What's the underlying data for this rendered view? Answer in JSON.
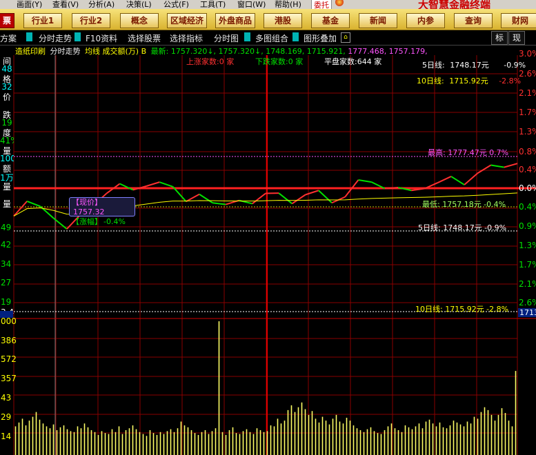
{
  "menubar": {
    "items": [
      "画面(Y)",
      "查看(V)",
      "分析(A)",
      "决策(L)",
      "公式(F)",
      "工具(T)",
      "窗口(W)",
      "帮助(H)"
    ],
    "trade_badge": "委托",
    "brand": "大智慧金融终端"
  },
  "function_buttons": [
    "票",
    "行业1",
    "行业2",
    "概念",
    "区域经济",
    "外盘商品",
    "港股",
    "基金",
    "新闻",
    "内参",
    "查询",
    "财网"
  ],
  "toolbar": {
    "items": [
      "方案",
      "分时走势",
      "F10资料",
      "选择股票",
      "选择指标",
      "分时图",
      "多图组合",
      "图形叠加"
    ],
    "right_buttons": [
      "标",
      "现"
    ]
  },
  "info_line": {
    "name": "造纸印刷",
    "chart_label": "分时走势",
    "indicators": "均线 成交额(万) B",
    "latest_label": "最新:",
    "latest_values": "1757.320↓, 1757.320↓, 1748.169, 1715.921,",
    "purple_values": "1777.468, 1757.179,"
  },
  "stats": {
    "rising": "上涨家数:0 家",
    "falling": "下跌家数:0 家",
    "flat": "平盘家数:644 家"
  },
  "ma_box": {
    "ma5_label": "5日线:",
    "ma5_value": "1748.17元",
    "ma5_pct": "-0.9%",
    "ma10_label": "10日线:",
    "ma10_value": "1715.92元",
    "ma10_pct": "-2.8%"
  },
  "overlays": {
    "high": "最高: 1777.47元 0.7%",
    "low": "最低: 1757.18元 -0.4%",
    "ma5": "5日线: 1748.17元 -0.9%",
    "ma10": "10日线: 1715.92元 -2.8%"
  },
  "tooltip": {
    "price_label": "【现价】",
    "price_value": "1757.32",
    "change_label": "【涨幅】",
    "change_value": "-0.4%"
  },
  "left_panel": [
    "间",
    "48",
    "格",
    "32",
    "价",
    "跌",
    "19",
    "度",
    "41%",
    "量",
    "100",
    "额",
    "1万",
    "量",
    "量"
  ],
  "left_price_axis": [
    "49",
    "42",
    "34",
    "27",
    "19",
    "3.4"
  ],
  "left_volume_axis": [
    "000",
    "386",
    "572",
    "357",
    "43",
    "29",
    "14"
  ],
  "right_axis_labels": [
    "3.0%",
    "2.6%",
    "2.1%",
    "1.7%",
    "1.3%",
    "0.8%",
    "0.4%",
    "0.0%",
    "0.4%",
    "0.9%",
    "1.3%",
    "1.7%",
    "2.1%",
    "2.6%"
  ],
  "right_volume_label": "1713",
  "colors": {
    "grid": "#8a0000",
    "up": "#ff3030",
    "down": "#00e000",
    "avg": "#ffff00",
    "zero": "#ff2020",
    "volume": "#ffff66",
    "purple": "#ff55ff"
  },
  "chart_data": [
    {
      "type": "line",
      "series": [
        {
          "values": [
            1757.0,
            1762.5,
            1760.6,
            1756.2,
            1752.2,
            1757.4,
            1760.9,
            1765.4,
            1769.0,
            1766.7,
            1768.1,
            1769.6,
            1767.9,
            1762.4,
            1765.1,
            1761.9,
            1761.3,
            1762.8,
            1761.6,
            1765.4,
            1765.5,
            1761.6,
            1764.9,
            1766.5,
            1761.9,
            1764.1,
            1770.4,
            1769.6,
            1767.2,
            1767.6,
            1766.5,
            1767.2,
            1769.4,
            1771.7,
            1768.6,
            1772.9,
            1775.9,
            1775.1,
            1776.5
          ]
        }
      ]
    },
    {
      "type": "bar",
      "values": [
        30,
        34,
        38,
        31,
        36,
        40,
        45,
        37,
        33,
        30,
        28,
        32,
        26,
        29,
        31,
        27,
        25,
        24,
        30,
        28,
        33,
        29,
        26,
        24,
        21,
        25,
        23,
        22,
        27,
        24,
        30,
        22,
        26,
        28,
        31,
        27,
        24,
        22,
        20,
        26,
        23,
        21,
        24,
        22,
        25,
        27,
        24,
        28,
        35,
        31,
        29,
        26,
        23,
        21,
        24,
        26,
        22,
        25,
        28,
        140,
        24,
        21,
        26,
        29,
        23,
        22,
        25,
        27,
        24,
        22,
        28,
        26,
        24,
        25,
        31,
        30,
        38,
        33,
        36,
        47,
        52,
        45,
        50,
        55,
        48,
        42,
        46,
        38,
        34,
        40,
        36,
        32,
        38,
        42,
        35,
        33,
        39,
        36,
        31,
        28,
        26,
        24,
        27,
        29,
        25,
        23,
        22,
        26,
        30,
        33,
        28,
        26,
        24,
        31,
        29,
        27,
        30,
        33,
        28,
        35,
        37,
        33,
        30,
        34,
        29,
        28,
        31,
        36,
        34,
        32,
        30,
        35,
        33,
        40,
        38,
        45,
        50,
        47,
        42,
        36,
        42,
        49,
        44,
        36,
        30,
        88
      ]
    }
  ]
}
